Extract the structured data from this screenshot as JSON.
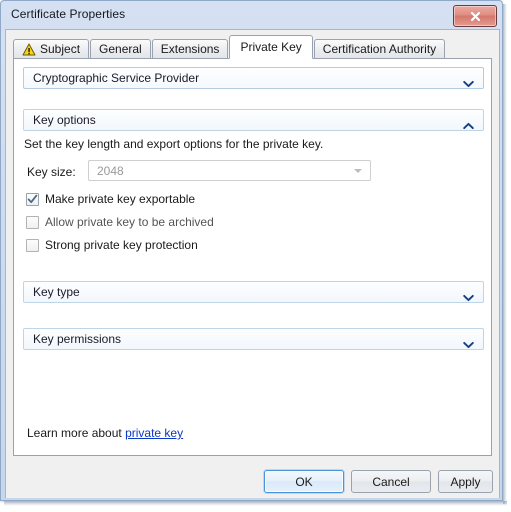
{
  "window": {
    "title": "Certificate Properties",
    "close_label": "✖",
    "close_icon": "close-icon"
  },
  "tabs": [
    {
      "label": "Subject",
      "icon": "warning-triangle-icon",
      "active": false
    },
    {
      "label": "General",
      "icon": "",
      "active": false
    },
    {
      "label": "Extensions",
      "icon": "",
      "active": false
    },
    {
      "label": "Private Key",
      "icon": "",
      "active": true
    },
    {
      "label": "Certification Authority",
      "icon": "",
      "active": false
    }
  ],
  "main": {
    "provider_combo": {
      "value": "Cryptographic Service Provider",
      "chevron": "chevron-down-icon"
    },
    "key_options_section": {
      "title": "Key options",
      "chevron": "chevron-up-icon",
      "expanded": true,
      "description": "Set the key length and export options for the private key.",
      "key_size_label": "Key size:",
      "key_size_value": "2048",
      "key_size_disabled": true,
      "checkboxes": [
        {
          "label": "Make private key exportable",
          "checked": true,
          "disabled": false
        },
        {
          "label": "Allow private key to be archived",
          "checked": false,
          "disabled": true
        },
        {
          "label": "Strong private key protection",
          "checked": false,
          "disabled": false
        }
      ]
    },
    "key_type_section": {
      "title": "Key type",
      "chevron": "chevron-down-icon",
      "expanded": false
    },
    "key_permissions_section": {
      "title": "Key permissions",
      "chevron": "chevron-down-icon",
      "expanded": false
    },
    "learn_more": {
      "prefix": "Learn more about ",
      "link_text": "private key"
    }
  },
  "footer": {
    "ok_label": "OK",
    "cancel_label": "Cancel",
    "apply_label": "Apply"
  },
  "colors": {
    "accent": "#4b93d8",
    "link": "#0a38c8",
    "titlebar": "#cddcef",
    "panel": "#ffffff",
    "dialog_bg": "#f0f0f0",
    "close_button": "#d4776c"
  }
}
